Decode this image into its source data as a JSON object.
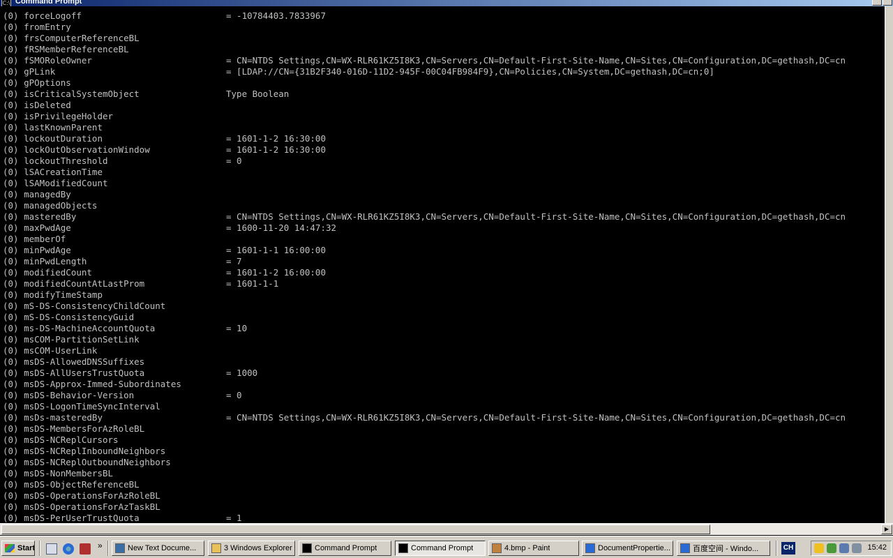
{
  "window": {
    "title": "Command Prompt"
  },
  "console": {
    "rows": [
      {
        "attr": "(0) forceLogoff",
        "val": "= -10784403.7833967"
      },
      {
        "attr": "(0) fromEntry",
        "val": ""
      },
      {
        "attr": "(0) frsComputerReferenceBL",
        "val": ""
      },
      {
        "attr": "(0) fRSMemberReferenceBL",
        "val": ""
      },
      {
        "attr": "(0) fSMORoleOwner",
        "val": "= CN=NTDS Settings,CN=WX-RLR61KZ5I8K3,CN=Servers,CN=Default-First-Site-Name,CN=Sites,CN=Configuration,DC=gethash,DC=cn"
      },
      {
        "attr": "(0) gPLink",
        "val": "= [LDAP://CN={31B2F340-016D-11D2-945F-00C04FB984F9},CN=Policies,CN=System,DC=gethash,DC=cn;0]"
      },
      {
        "attr": "(0) gPOptions",
        "val": ""
      },
      {
        "attr": "(0) isCriticalSystemObject",
        "val": "Type Boolean"
      },
      {
        "attr": "(0) isDeleted",
        "val": ""
      },
      {
        "attr": "(0) isPrivilegeHolder",
        "val": ""
      },
      {
        "attr": "(0) lastKnownParent",
        "val": ""
      },
      {
        "attr": "(0) lockoutDuration",
        "val": "= 1601-1-2 16:30:00"
      },
      {
        "attr": "(0) lockOutObservationWindow",
        "val": "= 1601-1-2 16:30:00"
      },
      {
        "attr": "(0) lockoutThreshold",
        "val": "= 0"
      },
      {
        "attr": "(0) lSACreationTime",
        "val": ""
      },
      {
        "attr": "(0) lSAModifiedCount",
        "val": ""
      },
      {
        "attr": "(0) managedBy",
        "val": ""
      },
      {
        "attr": "(0) managedObjects",
        "val": ""
      },
      {
        "attr": "(0) masteredBy",
        "val": "= CN=NTDS Settings,CN=WX-RLR61KZ5I8K3,CN=Servers,CN=Default-First-Site-Name,CN=Sites,CN=Configuration,DC=gethash,DC=cn"
      },
      {
        "attr": "(0) maxPwdAge",
        "val": "= 1600-11-20 14:47:32"
      },
      {
        "attr": "(0) memberOf",
        "val": ""
      },
      {
        "attr": "(0) minPwdAge",
        "val": "= 1601-1-1 16:00:00"
      },
      {
        "attr": "(0) minPwdLength",
        "val": "= 7"
      },
      {
        "attr": "(0) modifiedCount",
        "val": "= 1601-1-2 16:00:00"
      },
      {
        "attr": "(0) modifiedCountAtLastProm",
        "val": "= 1601-1-1"
      },
      {
        "attr": "(0) modifyTimeStamp",
        "val": ""
      },
      {
        "attr": "(0) mS-DS-ConsistencyChildCount",
        "val": ""
      },
      {
        "attr": "(0) mS-DS-ConsistencyGuid",
        "val": ""
      },
      {
        "attr": "(0) ms-DS-MachineAccountQuota",
        "val": "= 10"
      },
      {
        "attr": "(0) msCOM-PartitionSetLink",
        "val": ""
      },
      {
        "attr": "(0) msCOM-UserLink",
        "val": ""
      },
      {
        "attr": "(0) msDS-AllowedDNSSuffixes",
        "val": ""
      },
      {
        "attr": "(0) msDS-AllUsersTrustQuota",
        "val": "= 1000"
      },
      {
        "attr": "(0) msDS-Approx-Immed-Subordinates",
        "val": ""
      },
      {
        "attr": "(0) msDS-Behavior-Version",
        "val": "= 0"
      },
      {
        "attr": "(0) msDS-LogonTimeSyncInterval",
        "val": ""
      },
      {
        "attr": "(0) msDs-masteredBy",
        "val": "= CN=NTDS Settings,CN=WX-RLR61KZ5I8K3,CN=Servers,CN=Default-First-Site-Name,CN=Sites,CN=Configuration,DC=gethash,DC=cn"
      },
      {
        "attr": "(0) msDS-MembersForAzRoleBL",
        "val": ""
      },
      {
        "attr": "(0) msDS-NCReplCursors",
        "val": ""
      },
      {
        "attr": "(0) msDS-NCReplInboundNeighbors",
        "val": ""
      },
      {
        "attr": "(0) msDS-NCReplOutboundNeighbors",
        "val": ""
      },
      {
        "attr": "(0) msDS-NonMembersBL",
        "val": ""
      },
      {
        "attr": "(0) msDS-ObjectReferenceBL",
        "val": ""
      },
      {
        "attr": "(0) msDS-OperationsForAzRoleBL",
        "val": ""
      },
      {
        "attr": "(0) msDS-OperationsForAzTaskBL",
        "val": ""
      },
      {
        "attr": "(0) msDS-PerUserTrustQuota",
        "val": "= 1"
      }
    ]
  },
  "taskbar": {
    "start_label": "Start",
    "more_label": "»",
    "tasks": [
      {
        "label": "New Text Docume...",
        "icon": "notepad-icon",
        "color": "#3a6ea5",
        "active": false
      },
      {
        "label": "3 Windows Explorer",
        "icon": "folder-icon",
        "color": "#e8c15a",
        "active": false
      },
      {
        "label": "Command Prompt",
        "icon": "console-icon",
        "color": "#000000",
        "active": false
      },
      {
        "label": "Command Prompt",
        "icon": "console-icon",
        "color": "#000000",
        "active": true
      },
      {
        "label": "4.bmp - Paint",
        "icon": "paint-icon",
        "color": "#c08040",
        "active": false
      },
      {
        "label": "DocumentPropertie...",
        "icon": "ie-icon",
        "color": "#2a6ad5",
        "active": false
      },
      {
        "label": "百度空间 - Windo...",
        "icon": "ie-icon",
        "color": "#2a6ad5",
        "active": false
      }
    ],
    "language": "CH",
    "clock": "15:42"
  }
}
